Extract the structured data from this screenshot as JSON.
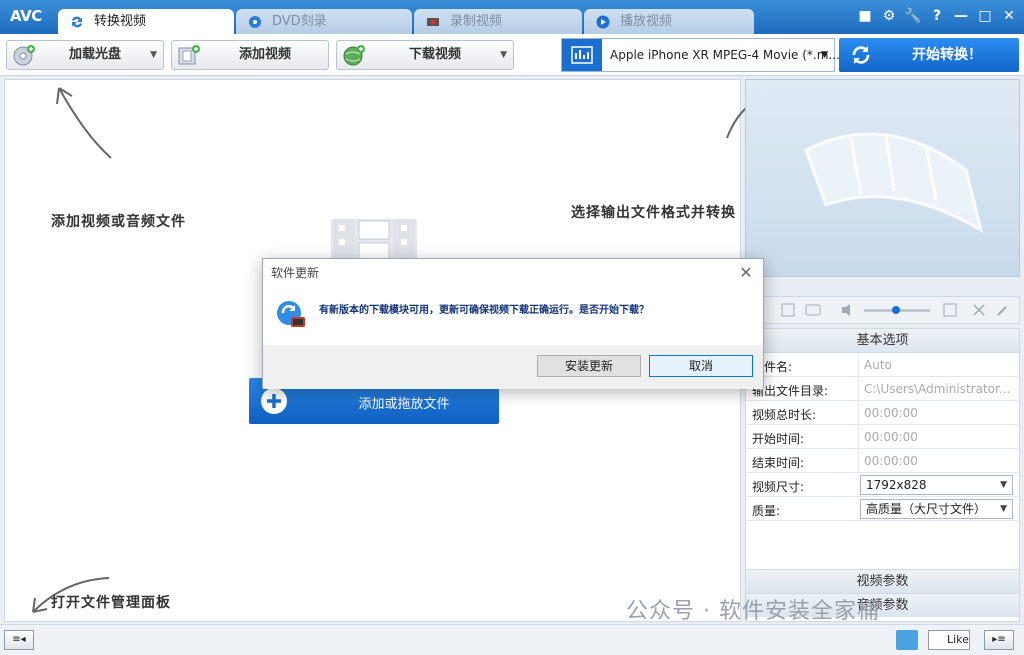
{
  "app": {
    "logo": "AVC"
  },
  "tabs": [
    {
      "label": "转换视频",
      "icon": "convert-icon",
      "active": true
    },
    {
      "label": "DVD刻录",
      "icon": "disc-icon",
      "active": false
    },
    {
      "label": "录制视频",
      "icon": "record-icon",
      "active": false
    },
    {
      "label": "播放视频",
      "icon": "play-icon",
      "active": false
    }
  ],
  "window_buttons": [
    "■",
    "⚙",
    "🔧",
    "?",
    "—",
    "□",
    "✕"
  ],
  "toolbar": {
    "load_disc": "加载光盘",
    "add_video": "添加视频",
    "download_video": "下载视频",
    "format": "Apple iPhone XR MPEG-4 Movie (*.m...",
    "start": "开始转换！"
  },
  "hints": {
    "add_files": "添加视频或音频文件",
    "choose_format": "选择输出文件格式并转换",
    "open_panel": "打开文件管理面板"
  },
  "main": {
    "add_file_button": "添加或拖放文件"
  },
  "properties": {
    "header": "基本选项",
    "rows": [
      {
        "label": "文件名:",
        "value": "Auto"
      },
      {
        "label": "输出文件目录:",
        "value": "C:\\Users\\Administrator..."
      },
      {
        "label": "视频总时长:",
        "value": "00:00:00"
      },
      {
        "label": "开始时间:",
        "value": "00:00:00"
      },
      {
        "label": "结束时间:",
        "value": "00:00:00"
      },
      {
        "label": "视频尺寸:",
        "value": "1792x828"
      },
      {
        "label": "质量:",
        "value": "高质量（大尺寸文件）"
      }
    ],
    "video_params": "视频参数",
    "audio_params": "音频参数"
  },
  "dialog": {
    "title": "软件更新",
    "message": "有新版本的下载模块可用，更新可确保视频下载正确运行。是否开始下载？",
    "install": "安装更新",
    "cancel": "取消"
  },
  "statusbar": {
    "like": "Like"
  },
  "watermark": "公众号 · 软件安装全家桶",
  "colors": {
    "accent": "#1a6fd1",
    "title_bar": "#2a7fd4"
  }
}
